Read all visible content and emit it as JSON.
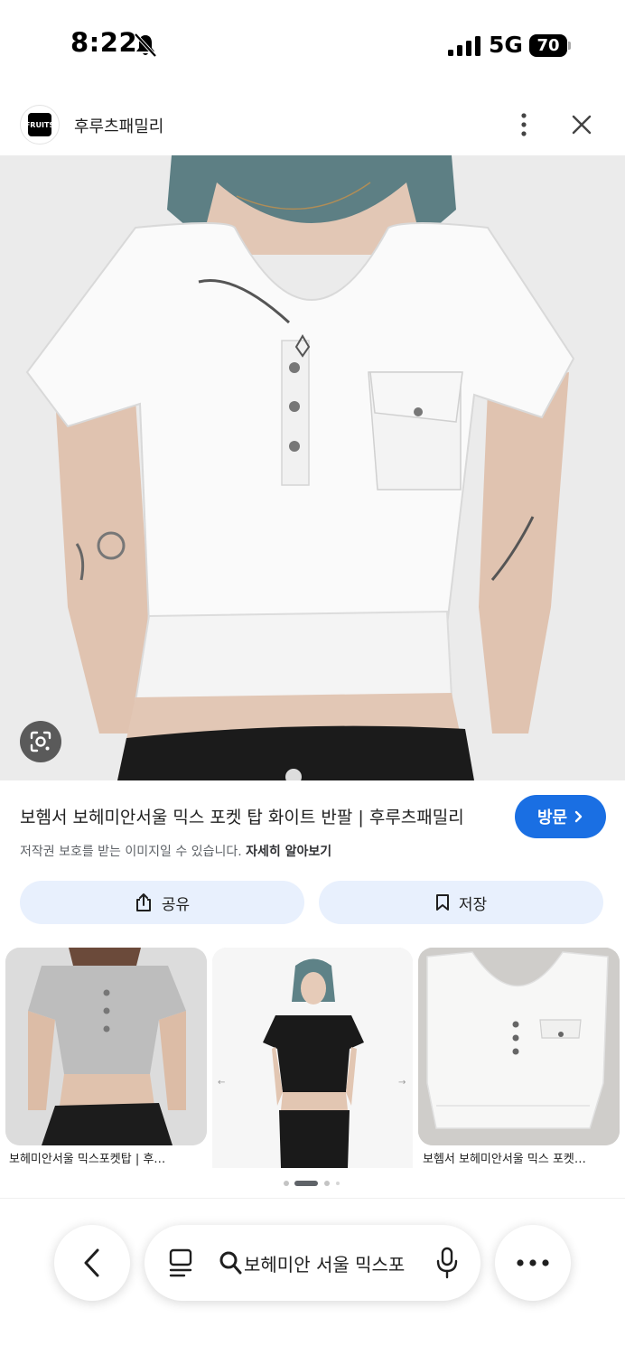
{
  "status_bar": {
    "time": "8:22",
    "network": "5G",
    "battery": "70"
  },
  "source": {
    "logo_text": "FRUITS",
    "name": "후루츠패밀리"
  },
  "result": {
    "title": "보헴서 보헤미안서울 믹스 포켓 탑 화이트 반팔 | 후루츠패밀리",
    "visit_label": "방문",
    "copyright_text": "저작권 보호를 받는 이미지일 수 있습니다.",
    "learn_more": "자세히 알아보기"
  },
  "actions": {
    "share_label": "공유",
    "save_label": "저장"
  },
  "related": [
    {
      "caption": "보헤미안서울 믹스포켓탑 | 후…"
    },
    {
      "caption": ""
    },
    {
      "caption": "보헴서 보헤미안서울 믹스 포켓…"
    }
  ],
  "search": {
    "query": "보헤미안 서울 믹스포"
  },
  "icons": [
    "mute-icon",
    "signal-icon",
    "more-vert-icon",
    "close-icon",
    "lens-icon",
    "chevron-right-icon",
    "share-icon",
    "bookmark-icon",
    "back-icon",
    "tabs-icon",
    "search-icon",
    "mic-icon",
    "more-horiz-icon"
  ],
  "colors": {
    "accent": "#1a6fe3",
    "chip_bg": "#e8f0fd"
  }
}
